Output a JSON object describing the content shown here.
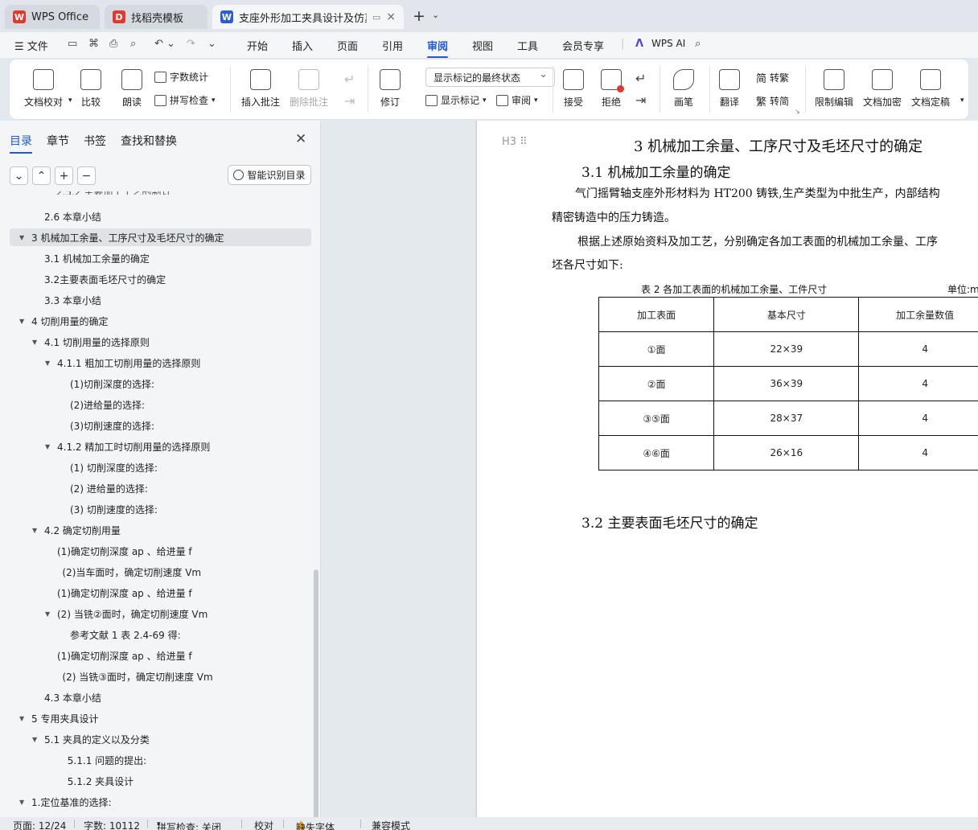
{
  "tabs": [
    {
      "label": "WPS Office",
      "logo": "W",
      "color": "#e03a2f"
    },
    {
      "label": "找稻壳模板",
      "logo": "D",
      "color": "#e03a2f"
    },
    {
      "label": "支座外形加工夹具设计及仿真",
      "logo": "W",
      "color": "#2b5dd6",
      "close": "×"
    }
  ],
  "menu": {
    "file": "文件",
    "items": [
      "开始",
      "插入",
      "页面",
      "引用",
      "审阅",
      "视图",
      "工具",
      "会员专享"
    ],
    "active": "审阅",
    "wps_ai": "WPS AI"
  },
  "ribbon": {
    "doc_check": "文档校对",
    "compare": "比较",
    "read_aloud": "朗读",
    "word_count": "字数统计",
    "spell_check": "拼写检查",
    "insert_comment": "插入批注",
    "delete_comment": "删除批注",
    "revise": "修订",
    "markup_state": "显示标记的最终状态",
    "show_markup": "显示标记",
    "review": "审阅",
    "accept": "接受",
    "reject": "拒绝",
    "pen": "画笔",
    "translate": "翻译",
    "to_traditional": "转繁",
    "to_simplified": "转简",
    "restrict_edit": "限制编辑",
    "encrypt": "文档加密",
    "finalize": "文档定稿"
  },
  "panel": {
    "tabs": [
      "目录",
      "章节",
      "书签",
      "查找和替换"
    ],
    "smart_toc": "智能识别目录",
    "toc": [
      {
        "text": "2.6   本章小结",
        "indent": 2,
        "arrow": ""
      },
      {
        "text": "3   机械加工余量、工序尺寸及毛坯尺寸的确定",
        "indent": 1,
        "arrow": "▼",
        "selected": true
      },
      {
        "text": "3.1   机械加工余量的确定",
        "indent": 2,
        "arrow": ""
      },
      {
        "text": "3.2主要表面毛坯尺寸的确定",
        "indent": 2,
        "arrow": ""
      },
      {
        "text": "3.3   本章小结",
        "indent": 2,
        "arrow": ""
      },
      {
        "text": "4   切削用量的确定",
        "indent": 1,
        "arrow": "▼"
      },
      {
        "text": "4.1   切削用量的选择原则",
        "indent": 2,
        "arrow": "▼"
      },
      {
        "text": "4.1.1   粗加工切削用量的选择原则",
        "indent": 3,
        "arrow": "▼"
      },
      {
        "text": "(1)切削深度的选择:",
        "indent": 4,
        "arrow": ""
      },
      {
        "text": "(2)进给量的选择:",
        "indent": 4,
        "arrow": ""
      },
      {
        "text": "(3)切削速度的选择:",
        "indent": 4,
        "arrow": ""
      },
      {
        "text": "4.1.2   精加工时切削用量的选择原则",
        "indent": 3,
        "arrow": "▼"
      },
      {
        "text": "(1)  切削深度的选择:",
        "indent": 4,
        "arrow": ""
      },
      {
        "text": "(2)  进给量的选择:",
        "indent": 4,
        "arrow": ""
      },
      {
        "text": "(3)  切削速度的选择:",
        "indent": 4,
        "arrow": ""
      },
      {
        "text": "4.2   确定切削用量",
        "indent": 2,
        "arrow": "▼"
      },
      {
        "text": "(1)确定切削深度 ap 、给进量 f",
        "indent": 3,
        "arrow": ""
      },
      {
        "text": "(2)当车面时，确定切削速度 Vm",
        "indent": 3.4,
        "arrow": ""
      },
      {
        "text": "(1)确定切削深度 ap 、给进量 f",
        "indent": 3,
        "arrow": ""
      },
      {
        "text": "(2)  当铣②面时，确定切削速度 Vm",
        "indent": 3,
        "arrow": "▼"
      },
      {
        "text": "参考文献 1 表 2.4-69 得:",
        "indent": 4,
        "arrow": ""
      },
      {
        "text": "(1)确定切削深度 ap 、给进量 f",
        "indent": 3,
        "arrow": ""
      },
      {
        "text": "(2)  当铣③面时，确定切削速度 Vm",
        "indent": 3.4,
        "arrow": ""
      },
      {
        "text": "4.3   本章小结",
        "indent": 2,
        "arrow": ""
      },
      {
        "text": "5   专用夹具设计",
        "indent": 1,
        "arrow": "▼"
      },
      {
        "text": "5.1  夹具的定义以及分类",
        "indent": 2,
        "arrow": "▼"
      },
      {
        "text": "5.1.1  问题的提出:",
        "indent": 3.8,
        "arrow": ""
      },
      {
        "text": "5.1.2    夹具设计",
        "indent": 3.8,
        "arrow": ""
      },
      {
        "text": "1.定位基准的选择:",
        "indent": 1,
        "arrow": "▼"
      }
    ]
  },
  "document": {
    "heading_mark": "H3",
    "chapter_title": "3   机械加工余量、工序尺寸及毛坯尺寸的确定",
    "sec1_title": "3.1   机械加工余量的确定",
    "p1_line1": "气门摇臂轴支座外形材料为 HT200 铸铁,生产类型为中批生产，内部结构",
    "p1_line2": "精密铸造中的压力铸造。",
    "p2_line1": "根据上述原始资料及加工艺，分别确定各加工表面的机械加工余量、工序",
    "p2_line2": "坯各尺寸如下:",
    "table_caption": "表 2  各加工表面的机械加工余量、工件尺寸",
    "unit": "单位:mm",
    "table": {
      "headers": [
        "加工表面",
        "基本尺寸",
        "加工余量数值"
      ],
      "rows": [
        [
          "①面",
          "22×39",
          "4"
        ],
        [
          "②面",
          "36×39",
          "4"
        ],
        [
          "③⑤面",
          "28×37",
          "4"
        ],
        [
          "④⑥面",
          "26×16",
          "4"
        ]
      ]
    },
    "sec2_title": "3.2    主要表面毛坯尺寸的确定"
  },
  "status": {
    "page": "页面: 12/24",
    "words": "字数: 10112",
    "spell": "拼写检查: 关闭",
    "proof": "校对",
    "missing_font": "缺失字体",
    "compat": "兼容模式"
  }
}
